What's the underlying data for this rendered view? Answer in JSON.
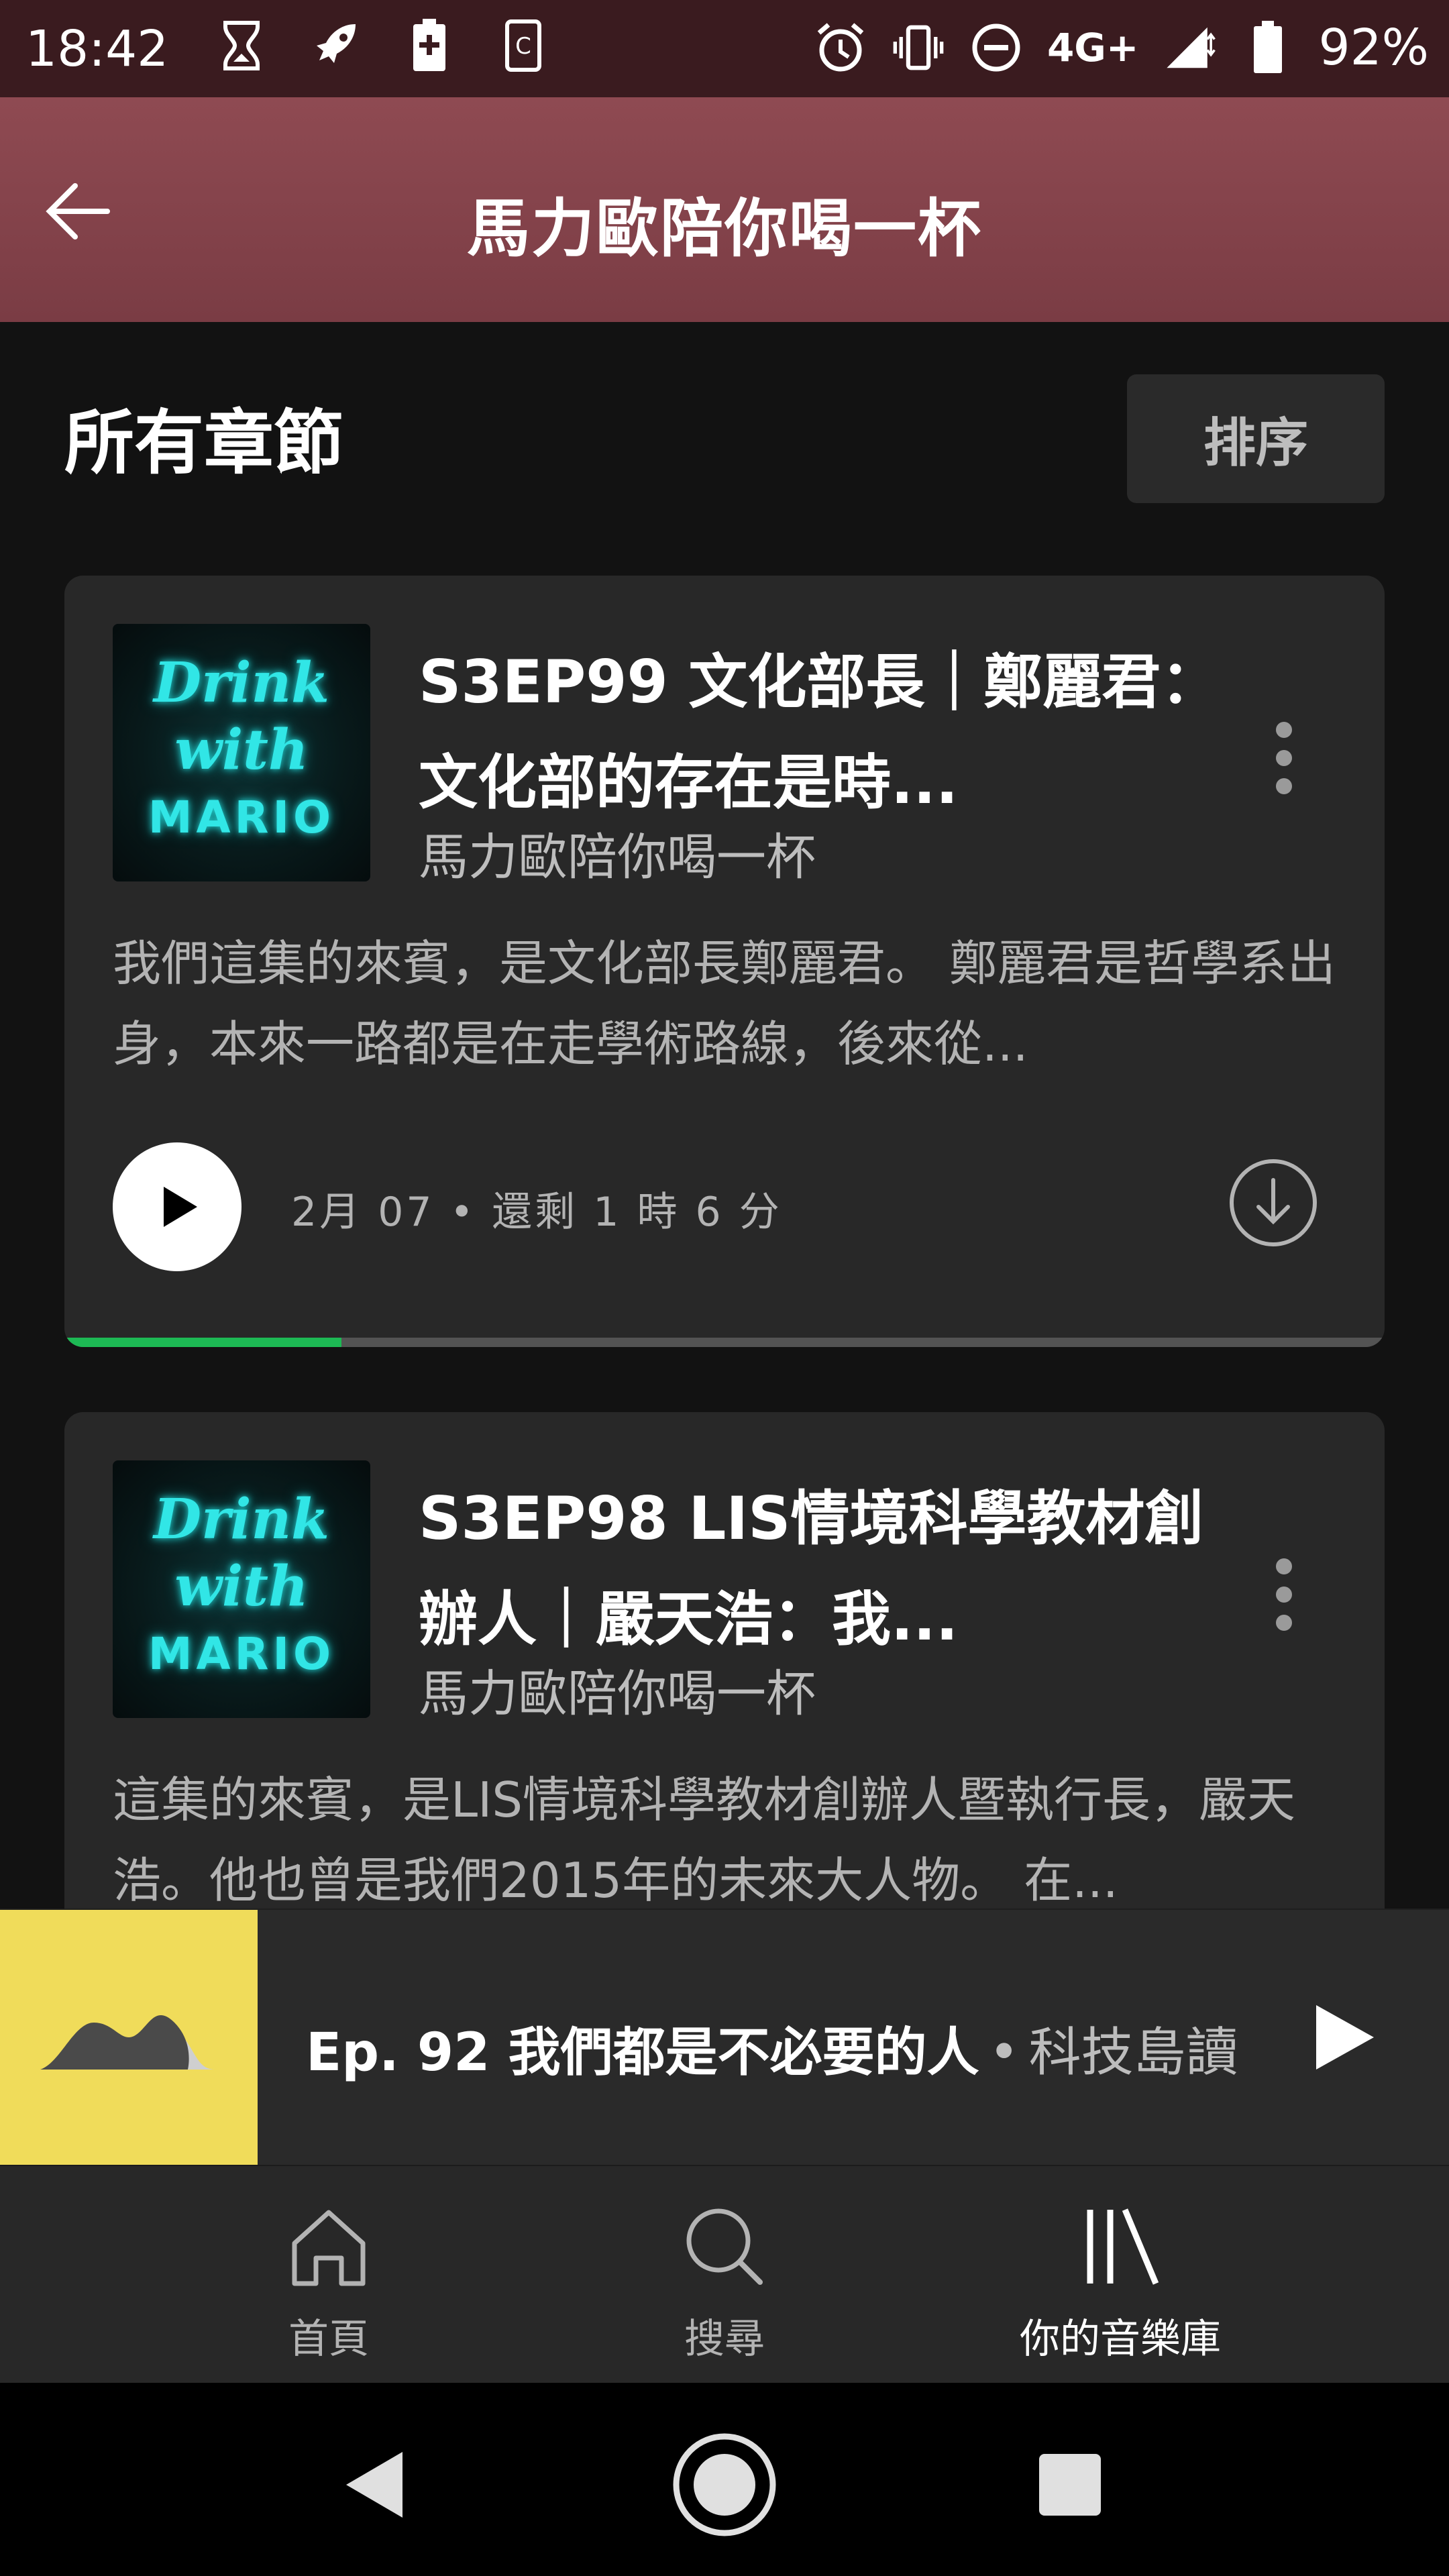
{
  "status_bar": {
    "time": "18:42",
    "network": "4G+",
    "battery": "92%"
  },
  "header": {
    "title": "馬力歐陪你喝一杯",
    "back_icon": "arrow-left-icon"
  },
  "section": {
    "title": "所有章節",
    "sort_label": "排序"
  },
  "cover_art": {
    "line1": "Drink",
    "line2": "with",
    "line3": "MARIO"
  },
  "episodes": [
    {
      "title": "S3EP99 文化部長｜鄭麗君：文化部的存在是時...",
      "show": "馬力歐陪你喝一杯",
      "description": "我們這集的來賓，是文化部長鄭麗君。 鄭麗君是哲學系出身，本來一路都是在走學術路線，後來從...",
      "meta": "2月 07 • 還剩 1 時 6 分",
      "progress": 0.21
    },
    {
      "title": "S3EP98 LIS情境科學教材創辦人｜嚴天浩：我...",
      "show": "馬力歐陪你喝一杯",
      "description": "這集的來賓，是LIS情境科學教材創辦人暨執行長，嚴天浩。他也曾是我們2015年的未來大人物。 在..."
    }
  ],
  "mini_player": {
    "title": "Ep. 92 我們都是不必要的人",
    "separator": "•",
    "show": "科技島讀",
    "cover_color": "#f0dc5a"
  },
  "bottom_nav": {
    "home": "首頁",
    "search": "搜尋",
    "library": "你的音樂庫"
  },
  "colors": {
    "accent": "#1db954",
    "header": "#8a454d"
  }
}
